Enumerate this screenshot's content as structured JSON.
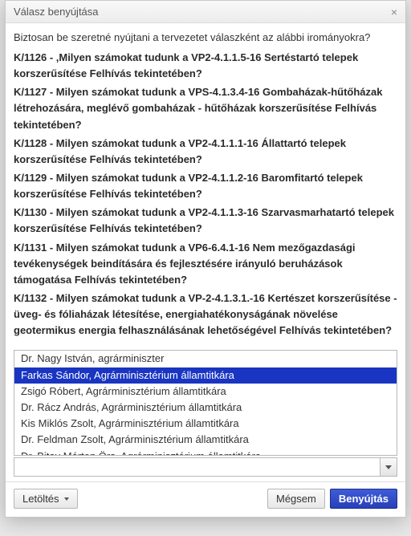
{
  "modal": {
    "title": "Válasz benyújtása",
    "close_glyph": "×",
    "intro": "Biztosan be szeretné nyújtani a tervezetet válaszként az alábbi irományokra?",
    "items": [
      "K/1126 - ,Milyen számokat tudunk a VP2-4.1.1.5-16 Sertéstartó telepek korszerűsítése Felhívás tekintetében?",
      "K/1127 - Milyen számokat tudunk a VPS-4.1.3.4-16 Gombaházak-hűtőházak létrehozására, meglévő gombaházak - hűtőházak korszerűsítése Felhívás tekintetében?",
      "K/1128 - Milyen számokat tudunk a VP2-4.1.1.1-16 Állattartó telepek korszerűsítése Felhívás tekintetében?",
      "K/1129 - Milyen számokat tudunk a VP2-4.1.1.2-16 Baromfitartó telepek korszerűsítése Felhívás tekintetében?",
      "K/1130 - Milyen számokat tudunk a VP2-4.1.1.3-16 Szarvasmarhatartó telepek korszerűsítése Felhívás tekintetében?",
      "K/1131 - Milyen számokat tudunk a VP6-6.4.1-16 Nem mezőgazdasági tevékenységek beindítására és fejlesztésére irányuló beruházások támogatása Felhívás tekintetében?",
      "K/1132 - Milyen számokat tudunk a VP-2-4.1.3.1.-16 Kertészet korszerűsítése - üveg- és fóliaházak létesítése, energiahatékonyságának növelése geotermikus energia felhasználásának lehetőségével Felhívás tekintetében?"
    ]
  },
  "dropdown": {
    "selected_index": 1,
    "options": [
      "Dr. Nagy István, agrárminiszter",
      "Farkas Sándor, Agrárminisztérium államtitkára",
      "Zsigó Róbert, Agrárminisztérium államtitkára",
      "Dr. Rácz András, Agrárminisztérium államtitkára",
      "Kis Miklós Zsolt, Agrárminisztérium államtitkára",
      "Dr. Feldman Zsolt, Agrárminisztérium államtitkára",
      "Dr. Bitay Márton Örs, Agrárminisztérium államtitkára"
    ],
    "input_value": ""
  },
  "footer": {
    "download_label": "Letöltés",
    "cancel_label": "Mégsem",
    "submit_label": "Benyújtás"
  }
}
